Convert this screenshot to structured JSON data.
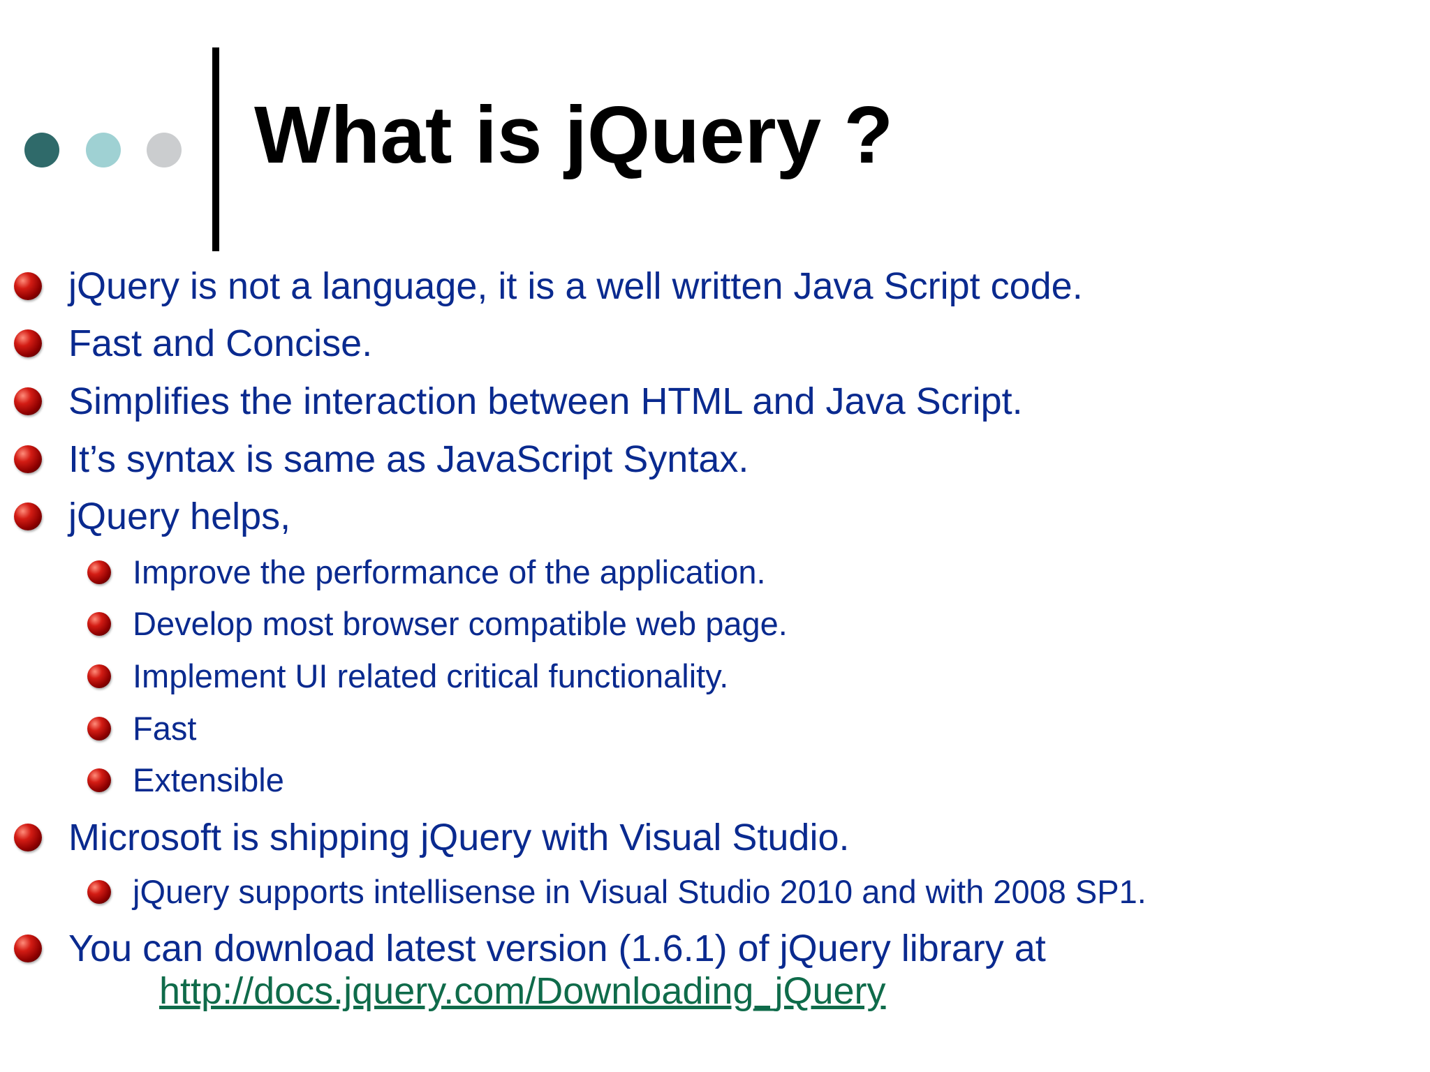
{
  "slide": {
    "title": "What is jQuery ?",
    "bullets": [
      {
        "level": 1,
        "text": "jQuery is not a language, it is a well written Java Script code."
      },
      {
        "level": 1,
        "text": "Fast and Concise."
      },
      {
        "level": 1,
        "text": "Simplifies the interaction between HTML and Java Script."
      },
      {
        "level": 1,
        "text": "It’s syntax is same as JavaScript Syntax."
      },
      {
        "level": 1,
        "text": "jQuery helps,"
      },
      {
        "level": 2,
        "text": "Improve the performance of the application."
      },
      {
        "level": 2,
        "text": "Develop most browser compatible web page."
      },
      {
        "level": 2,
        "text": "Implement UI related critical functionality."
      },
      {
        "level": 2,
        "text": "Fast"
      },
      {
        "level": 2,
        "text": "Extensible"
      },
      {
        "level": 1,
        "text": "Microsoft is shipping jQuery with Visual Studio."
      },
      {
        "level": 2,
        "text": "jQuery supports intellisense in Visual Studio 2010 and with 2008 SP1."
      },
      {
        "level": 1,
        "text": "You can download latest version (1.6.1) of jQuery library at"
      }
    ],
    "link": {
      "text": "http://docs.jquery.com/Downloading_jQuery"
    }
  },
  "colors": {
    "text": "#0a2a8f",
    "title": "#000000",
    "link": "#0f6b4a",
    "bullet": "#c0140c",
    "dot_1": "#2f6a6a",
    "dot_2": "#9fd1d3",
    "dot_3": "#cbcdcf"
  },
  "icons": {
    "header_dots": [
      "dot-icon",
      "dot-icon",
      "dot-icon"
    ],
    "bullet": "red-sphere-bullet-icon"
  }
}
